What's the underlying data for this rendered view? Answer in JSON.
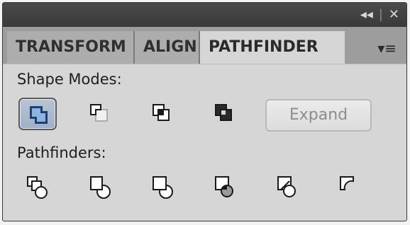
{
  "titlebar": {
    "collapse_icon": "collapse-arrows-icon",
    "close_icon": "close-icon",
    "collapse_glyph": "◂◂",
    "close_glyph": "✕",
    "separator": "|"
  },
  "tabs": [
    {
      "label": "TRANSFORM",
      "active": false
    },
    {
      "label": "ALIGN",
      "active": false
    },
    {
      "label": "PATHFINDER",
      "active": true
    }
  ],
  "panel_menu_icon": "panel-menu-icon",
  "panel_menu_glyph": "▾≡",
  "shape_modes": {
    "label": "Shape Modes:",
    "buttons": [
      {
        "name": "unite",
        "selected": true
      },
      {
        "name": "minus-front",
        "selected": false
      },
      {
        "name": "intersect",
        "selected": false
      },
      {
        "name": "exclude",
        "selected": false
      }
    ],
    "expand_label": "Expand"
  },
  "pathfinders": {
    "label": "Pathfinders:",
    "buttons": [
      "divide",
      "trim",
      "merge",
      "crop",
      "outline",
      "minus-back"
    ]
  },
  "colors": {
    "panel_bg": "#d6d6d6",
    "titlebar_bg": "#3a3a3a",
    "selected_bg": "#a9b8cc"
  }
}
